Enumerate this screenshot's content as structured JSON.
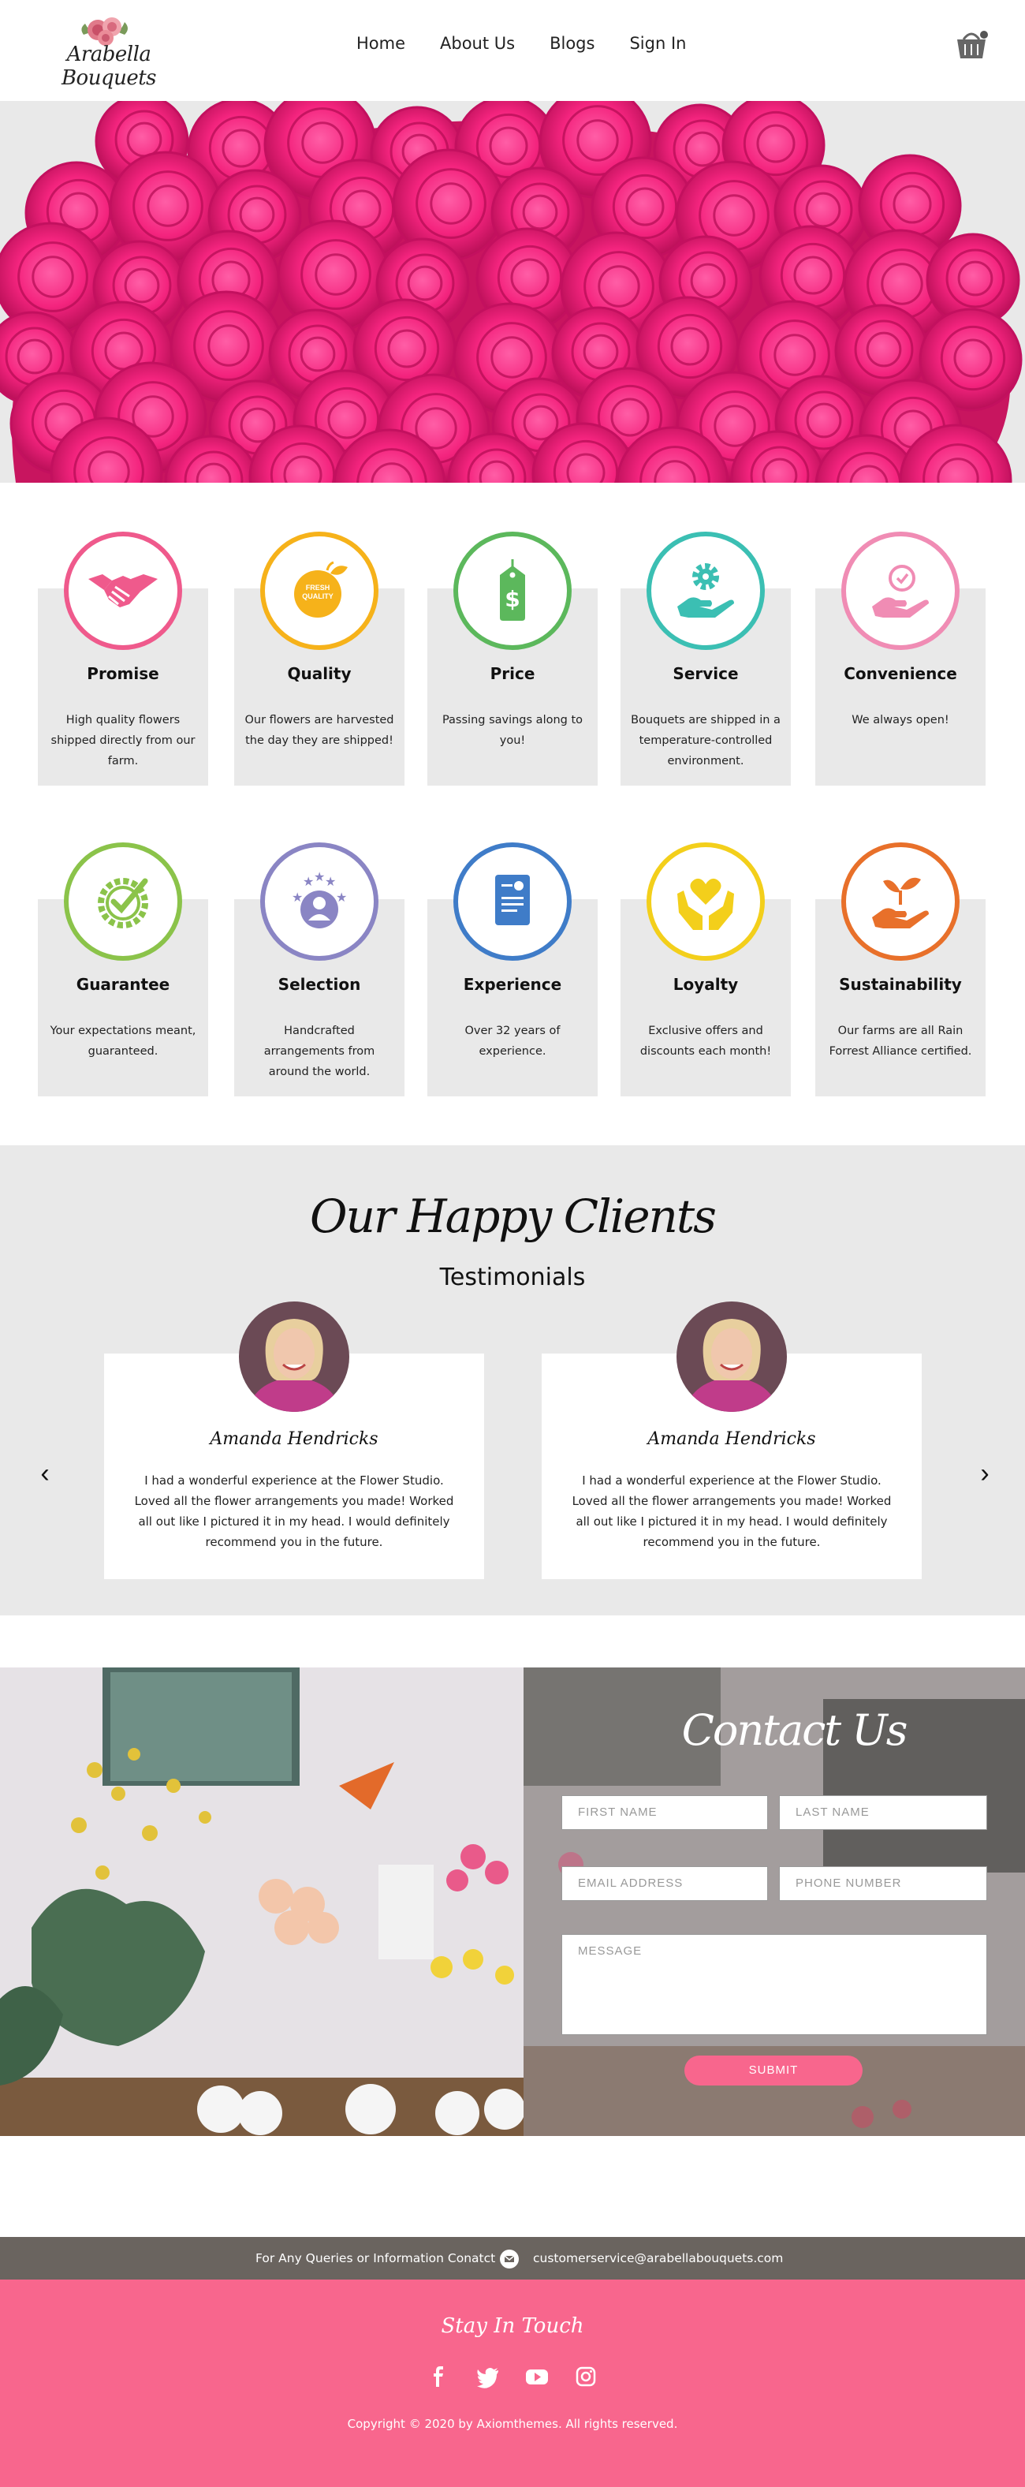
{
  "brand": {
    "logo_text": "Arabella Bouquets"
  },
  "nav": {
    "items": [
      "Home",
      "About Us",
      "Blogs",
      "Sign In"
    ]
  },
  "colors": {
    "accent_pink": "#f8668d",
    "panel_gray": "#e9e9e9",
    "info_bar": "#6a645f"
  },
  "features_row1": [
    {
      "title": "Promise",
      "desc": "High quality flowers shipped directly from our farm.",
      "icon": "handshake-icon",
      "color": "#ef5a8c"
    },
    {
      "title": "Quality",
      "desc": "Our flowers are harvested the day they are shipped!",
      "icon": "fresh-quality-badge-icon",
      "badge_text": "FRESH QUALITY",
      "color": "#f6b21a"
    },
    {
      "title": "Price",
      "desc": "Passing savings along to you!",
      "icon": "price-tag-icon",
      "color": "#5cb85c"
    },
    {
      "title": "Service",
      "desc": "Bouquets are shipped in a temperature-controlled environment.",
      "icon": "gear-hand-icon",
      "color": "#3bbfb3"
    },
    {
      "title": "Convenience",
      "desc": "We always open!",
      "icon": "clock-hand-icon",
      "color": "#f08cb4"
    }
  ],
  "features_row2": [
    {
      "title": "Guarantee",
      "desc": "Your expectations meant, guaranteed.",
      "icon": "check-seal-icon",
      "color": "#8bc34a"
    },
    {
      "title": "Selection",
      "desc": "Handcrafted arrangements from around the world.",
      "icon": "user-stars-icon",
      "color": "#8a85c4"
    },
    {
      "title": "Experience",
      "desc": "Over 32 years of experience.",
      "icon": "certificate-icon",
      "color": "#3f7cc8"
    },
    {
      "title": "Loyalty",
      "desc": "Exclusive offers and discounts each month!",
      "icon": "heart-hands-icon",
      "color": "#f3cf1b"
    },
    {
      "title": "Sustainability",
      "desc": "Our farms are all Rain Forrest Alliance certified.",
      "icon": "plant-hand-icon",
      "color": "#e8702a"
    }
  ],
  "testimonials": {
    "heading": "Our Happy Clients",
    "subheading": "Testimonials",
    "items": [
      {
        "name": "Amanda Hendricks",
        "quote": "I had a wonderful experience at the Flower Studio. Loved all the flower arrangements you made! Worked all out like I pictured it in my head. I would definitely recommend you in the future."
      },
      {
        "name": "Amanda Hendricks",
        "quote": "I had a wonderful experience at the Flower Studio. Loved all the flower arrangements you made! Worked all out like I pictured it in my head. I would definitely recommend you in the future."
      }
    ],
    "prev": "‹",
    "next": "›"
  },
  "contact": {
    "title": "Contact Us",
    "first_name": "FIRST NAME",
    "last_name": "LAST NAME",
    "email": "EMAIL ADDRESS",
    "phone": "PHONE NUMBER",
    "message": "MESSAGE",
    "submit": "SUBMIT"
  },
  "info_bar": {
    "text": "For Any Queries or Information Conatct",
    "email": "customerservice@arabellabouquets.com"
  },
  "footer": {
    "stay": "Stay In Touch",
    "social": [
      "facebook-icon",
      "twitter-icon",
      "youtube-icon",
      "instagram-icon"
    ],
    "copyright": "Copyright © 2020 by Axiomthemes. All rights reserved."
  }
}
